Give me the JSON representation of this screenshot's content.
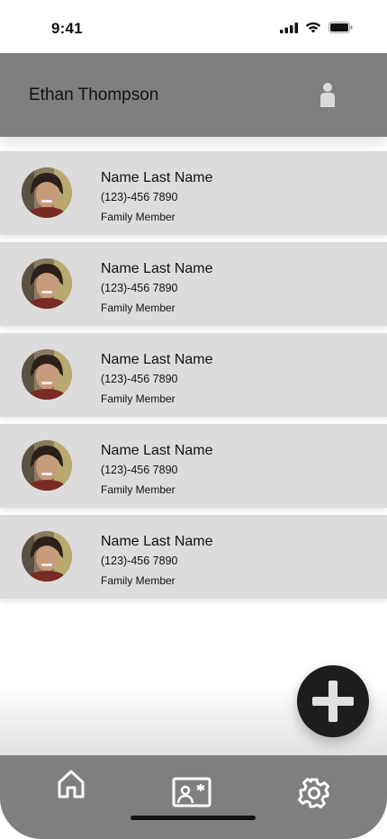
{
  "status_bar": {
    "time": "9:41"
  },
  "header": {
    "title": "Ethan Thompson"
  },
  "contacts": [
    {
      "name": "Name Last Name",
      "phone": "(123)-456 7890",
      "relation": "Family Member"
    },
    {
      "name": "Name Last Name",
      "phone": "(123)-456 7890",
      "relation": "Family Member"
    },
    {
      "name": "Name Last Name",
      "phone": "(123)-456 7890",
      "relation": "Family Member"
    },
    {
      "name": "Name Last Name",
      "phone": "(123)-456 7890",
      "relation": "Family Member"
    },
    {
      "name": "Name Last Name",
      "phone": "(123)-456 7890",
      "relation": "Family Member"
    }
  ],
  "tabs": [
    {
      "icon": "home-icon"
    },
    {
      "icon": "contact-card-icon"
    },
    {
      "icon": "gear-icon"
    }
  ],
  "colors": {
    "header": "#7f7f7f",
    "card": "#dcdcdc",
    "fab": "#1d1d1d",
    "tab_bar": "#7f7f7f"
  }
}
